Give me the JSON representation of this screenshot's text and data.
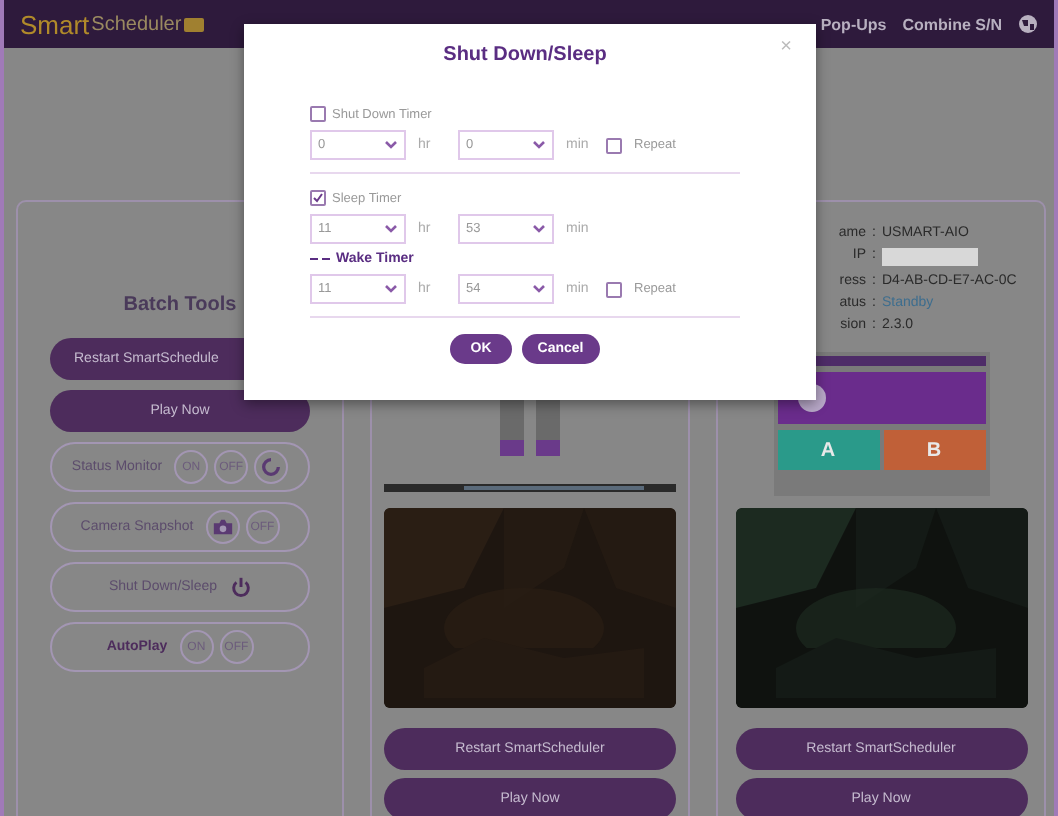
{
  "header": {
    "logo_primary": "Smart",
    "logo_secondary": "Scheduler",
    "nav": [
      "Pop-Ups",
      "Combine S/N"
    ]
  },
  "batch_tools": {
    "title": "Batch Tools",
    "items": [
      {
        "kind": "button",
        "label": "Restart SmartSchedule"
      },
      {
        "kind": "button",
        "label": "Play Now"
      },
      {
        "kind": "group",
        "label": "Status Monitor",
        "emphasis": false,
        "controls": [
          {
            "kind": "text",
            "label": "ON"
          },
          {
            "kind": "text",
            "label": "OFF"
          },
          {
            "kind": "refresh"
          }
        ]
      },
      {
        "kind": "group",
        "label": "Camera Snapshot",
        "emphasis": false,
        "controls": [
          {
            "kind": "camera"
          },
          {
            "kind": "text",
            "label": "OFF"
          }
        ]
      },
      {
        "kind": "group",
        "label": "Shut Down/Sleep",
        "emphasis": false,
        "controls": [
          {
            "kind": "power"
          }
        ]
      },
      {
        "kind": "group",
        "label": "AutoPlay",
        "emphasis": true,
        "controls": [
          {
            "kind": "text",
            "label": "ON"
          },
          {
            "kind": "text",
            "label": "OFF"
          }
        ]
      }
    ]
  },
  "devices": [
    {
      "thumbnail": {
        "kind": "bars"
      },
      "buttons": [
        "Restart SmartScheduler",
        "Play Now"
      ]
    },
    {
      "info": [
        {
          "label": "ame",
          "sep": ":",
          "value": "USMART-AIO",
          "kind": "text"
        },
        {
          "label": "IP",
          "sep": ":",
          "kind": "masked"
        },
        {
          "label": "ress",
          "sep": ":",
          "value": "D4-AB-CD-E7-AC-0C",
          "kind": "text"
        },
        {
          "label": "atus",
          "sep": ":",
          "value": "Standby",
          "kind": "status"
        },
        {
          "label": "sion",
          "sep": ":",
          "value": "2.3.0",
          "kind": "text"
        }
      ],
      "thumbnail": {
        "kind": "app",
        "tiles": [
          "A",
          "B"
        ]
      },
      "buttons": [
        "Restart SmartScheduler",
        "Play Now"
      ]
    }
  ],
  "dialog": {
    "title": "Shut Down/Sleep",
    "close": "×",
    "sections": [
      {
        "kind": "timer",
        "label": "Shut Down Timer",
        "checked": false,
        "hours": "0",
        "minutes": "0",
        "hr": "hr",
        "min": "min",
        "repeat": {
          "label": "Repeat",
          "checked": false
        }
      },
      {
        "kind": "timer",
        "label": "Sleep Timer",
        "checked": true,
        "hours": "11",
        "minutes": "53",
        "hr": "hr",
        "min": "min"
      },
      {
        "kind": "wake",
        "label": "Wake Timer",
        "hours": "11",
        "minutes": "54",
        "hr": "hr",
        "min": "min",
        "repeat": {
          "label": "Repeat",
          "checked": false
        }
      }
    ],
    "buttons": [
      "OK",
      "Cancel"
    ]
  }
}
